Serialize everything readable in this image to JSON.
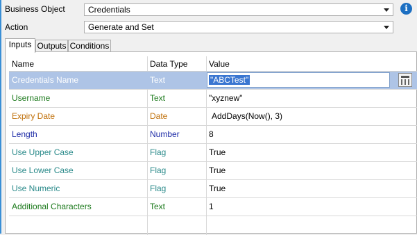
{
  "form": {
    "business_object_label": "Business Object",
    "business_object_value": "Credentials",
    "action_label": "Action",
    "action_value": "Generate and Set",
    "info_glyph": "i"
  },
  "tabs": [
    {
      "label": "Inputs",
      "active": true
    },
    {
      "label": "Outputs",
      "active": false
    },
    {
      "label": "Conditions",
      "active": false
    }
  ],
  "grid": {
    "headers": [
      "Name",
      "Data Type",
      "Value"
    ],
    "rows": [
      {
        "name": "Credentials Name",
        "type": "Text",
        "value": "\"ABCTest\"",
        "color": "#1d65b8",
        "selected": true
      },
      {
        "name": "Username",
        "type": "Text",
        "value": "\"xyznew\"",
        "color": "#1d7a1d"
      },
      {
        "name": "Expiry Date",
        "type": "Date",
        "value": "AddDays(Now(), 3)",
        "color": "#c0700a"
      },
      {
        "name": "Length",
        "type": "Number",
        "value": "8",
        "color": "#1c2aa6"
      },
      {
        "name": "Use Upper Case",
        "type": "Flag",
        "value": "True",
        "color": "#2a8a8a"
      },
      {
        "name": "Use Lower Case",
        "type": "Flag",
        "value": "True",
        "color": "#2a8a8a"
      },
      {
        "name": "Use Numeric",
        "type": "Flag",
        "value": "True",
        "color": "#2a8a8a"
      },
      {
        "name": "Additional Characters",
        "type": "Text",
        "value": "1",
        "color": "#1d7a1d"
      }
    ]
  },
  "icons": {
    "info": "info-icon",
    "dropdown": "chevron-down-icon",
    "calculator": "calculator-icon"
  }
}
